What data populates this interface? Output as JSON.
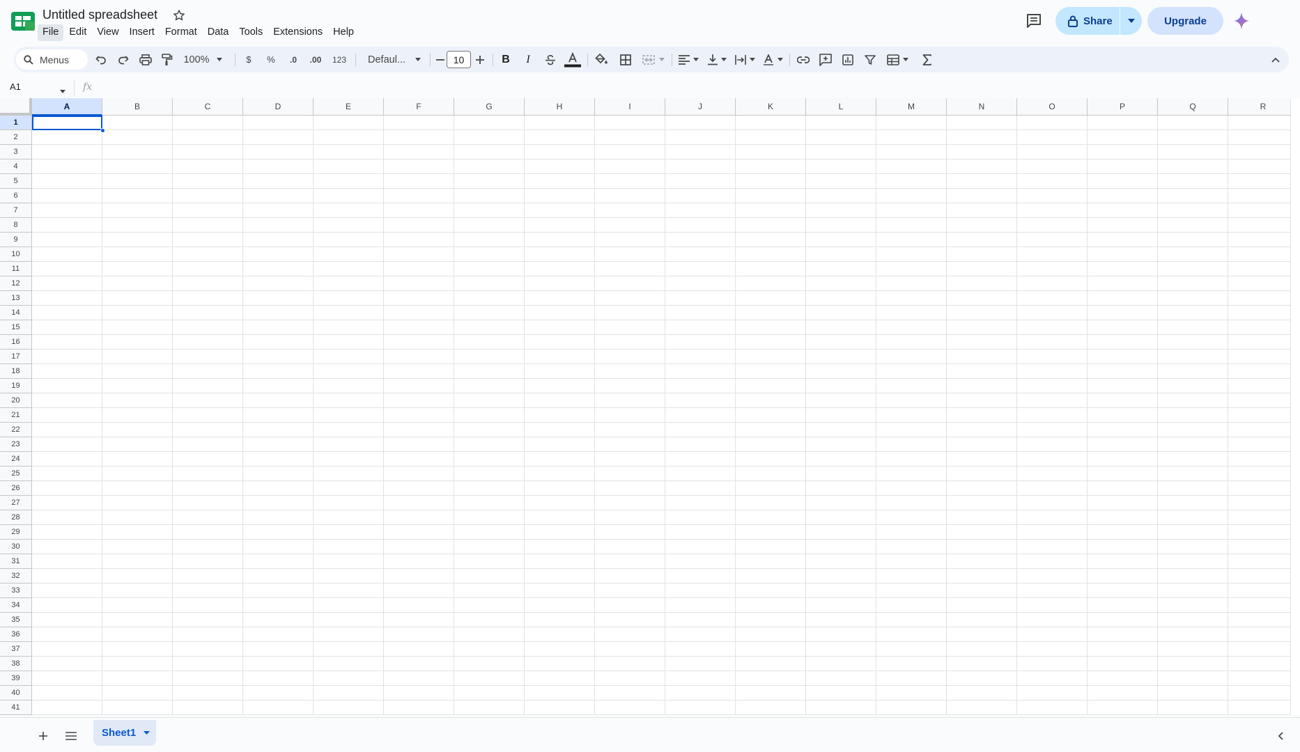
{
  "header": {
    "doc_title": "Untitled spreadsheet",
    "menus": [
      "File",
      "Edit",
      "View",
      "Insert",
      "Format",
      "Data",
      "Tools",
      "Extensions",
      "Help"
    ],
    "share_label": "Share",
    "upgrade_label": "Upgrade"
  },
  "toolbar": {
    "search_label": "Menus",
    "zoom": "100%",
    "currency": "$",
    "percent": "%",
    "decrease_decimal": ".0",
    "increase_decimal": ".00",
    "number_format": "123",
    "font": "Defaul...",
    "font_size": "10"
  },
  "formula_bar": {
    "name_box": "A1",
    "fx_label": "fx"
  },
  "grid": {
    "columns": [
      "A",
      "B",
      "C",
      "D",
      "E",
      "F",
      "G",
      "H",
      "I",
      "J",
      "K",
      "L",
      "M",
      "N",
      "O",
      "P",
      "Q",
      "R"
    ],
    "rows": [
      "1",
      "2",
      "3",
      "4",
      "5",
      "6",
      "7",
      "8",
      "9",
      "10",
      "11",
      "12",
      "13",
      "14",
      "15",
      "16",
      "17",
      "18",
      "19",
      "20",
      "21",
      "22",
      "23",
      "24",
      "25",
      "26",
      "27",
      "28",
      "29",
      "30",
      "31",
      "32",
      "33",
      "34",
      "35",
      "36",
      "37",
      "38",
      "39",
      "40",
      "41"
    ],
    "selected_cell": "A1"
  },
  "sheets": {
    "tabs": [
      "Sheet1"
    ]
  },
  "colors": {
    "brand_green": "#0f9d58",
    "accent_blue": "#0b57d0",
    "share_bg": "#c2e7ff",
    "upgrade_bg": "#d3e3fd"
  }
}
